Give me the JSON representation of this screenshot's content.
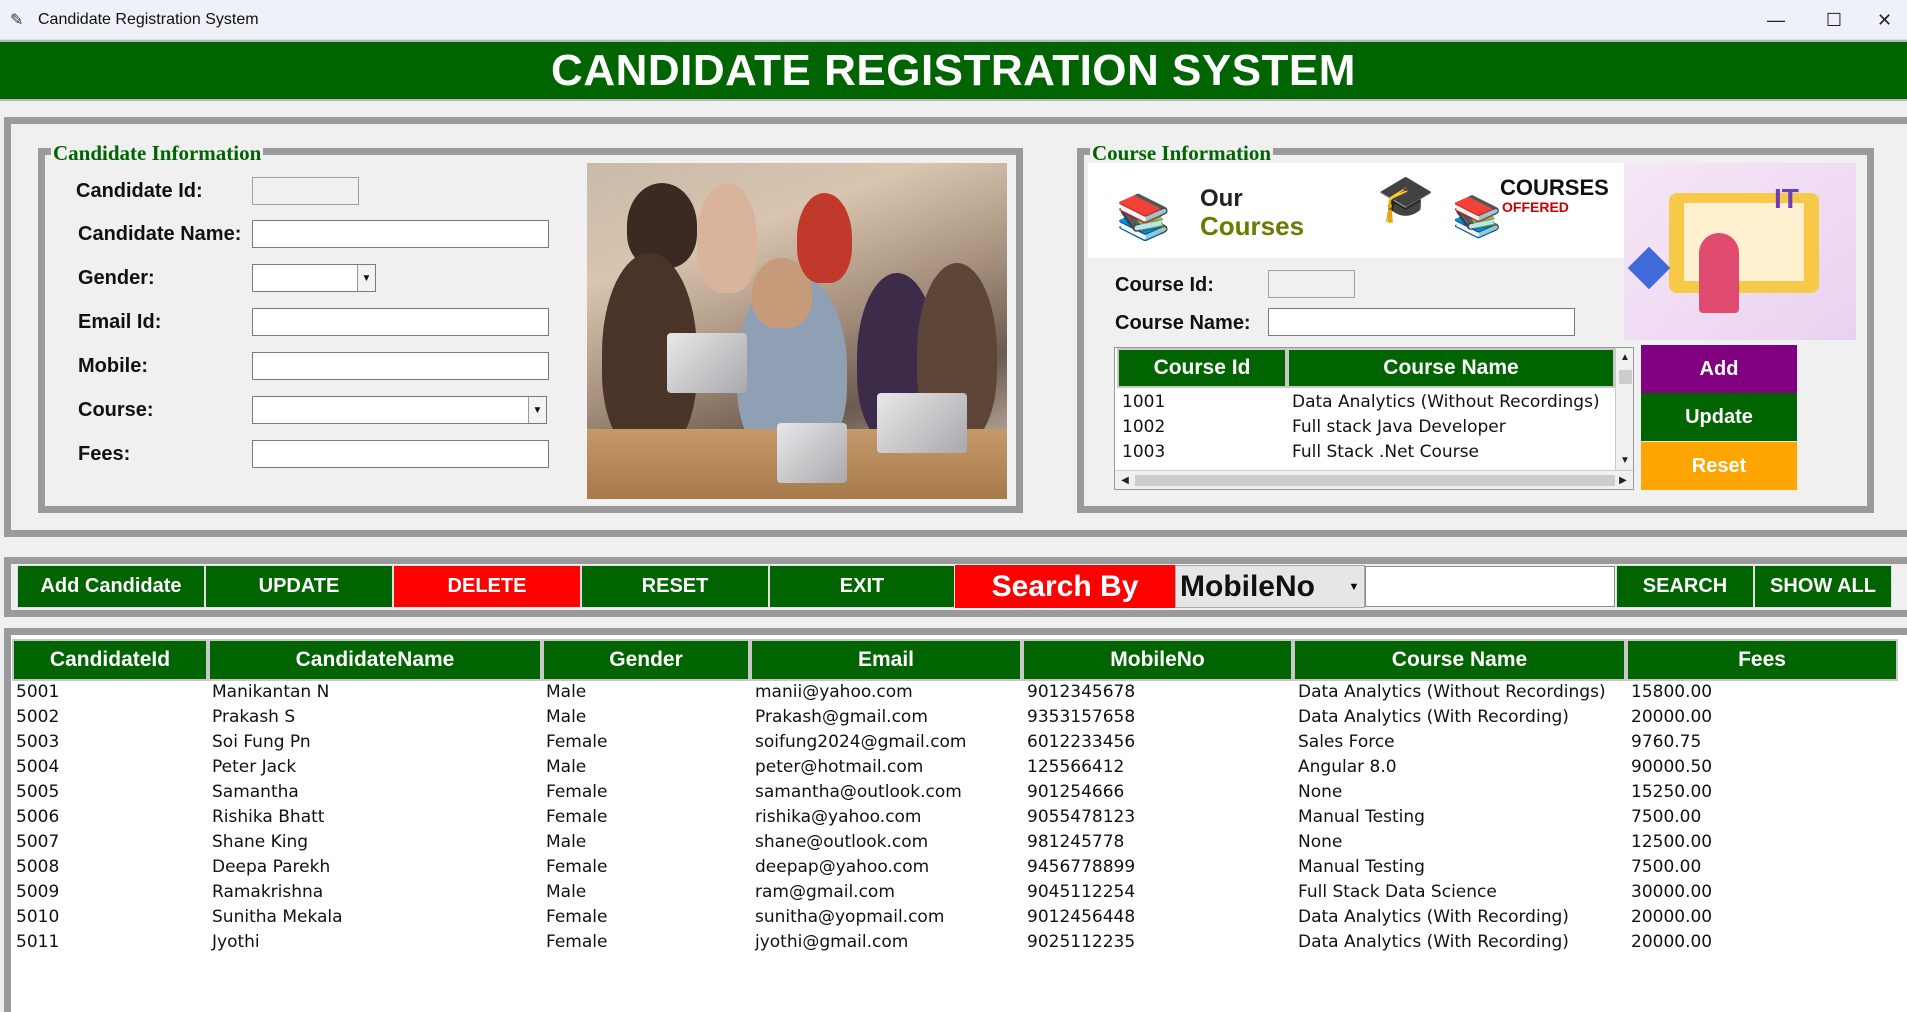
{
  "window": {
    "title": "Candidate Registration System"
  },
  "header": {
    "title": "CANDIDATE REGISTRATION SYSTEM"
  },
  "candidate_info": {
    "group_title": "Candidate Information",
    "labels": {
      "id": "Candidate Id:",
      "name": "Candidate Name:",
      "gender": "Gender:",
      "email": "Email Id:",
      "mobile": "Mobile:",
      "course": "Course:",
      "fees": "Fees:"
    },
    "values": {
      "id": "",
      "name": "",
      "gender": "",
      "email": "",
      "mobile": "",
      "course": "",
      "fees": ""
    }
  },
  "course_info": {
    "group_title": "Course Information",
    "banner1_line1": "Our",
    "banner1_line2": "Courses",
    "banner2_line1": "COURSES",
    "banner2_line2": "OFFERED",
    "banner3_text": "IT",
    "labels": {
      "id": "Course Id:",
      "name": "Course Name:"
    },
    "values": {
      "id": "",
      "name": ""
    },
    "table": {
      "columns": [
        "Course Id",
        "Course Name"
      ],
      "rows": [
        [
          "1001",
          "Data Analytics (Without Recordings)"
        ],
        [
          "1002",
          "Full stack Java Developer"
        ],
        [
          "1003",
          "Full Stack .Net Course"
        ]
      ]
    },
    "buttons": {
      "add": "Add",
      "update": "Update",
      "reset": "Reset"
    }
  },
  "toolbar": {
    "add_candidate": "Add Candidate",
    "update": "UPDATE",
    "delete": "DELETE",
    "reset": "RESET",
    "exit": "EXIT",
    "search_by": "Search By",
    "search_field": "MobileNo",
    "search_value": "",
    "search": "SEARCH",
    "show_all": "SHOW ALL"
  },
  "candidates_table": {
    "columns": [
      "CandidateId",
      "CandidateName",
      "Gender",
      "Email",
      "MobileNo",
      "Course Name",
      "Fees"
    ],
    "rows": [
      [
        "5001",
        "Manikantan N",
        "Male",
        "manii@yahoo.com",
        "9012345678",
        "Data Analytics (Without Recordings)",
        "15800.00"
      ],
      [
        "5002",
        "Prakash S",
        "Male",
        "Prakash@gmail.com",
        "9353157658",
        "Data Analytics (With Recording)",
        "20000.00"
      ],
      [
        "5003",
        "Soi Fung Pn",
        "Female",
        "soifung2024@gmail.com",
        "6012233456",
        "Sales Force",
        "9760.75"
      ],
      [
        "5004",
        "Peter Jack",
        "Male",
        "peter@hotmail.com",
        "125566412",
        "Angular 8.0",
        "90000.50"
      ],
      [
        "5005",
        "Samantha",
        "Female",
        "samantha@outlook.com",
        "901254666",
        "None",
        "15250.00"
      ],
      [
        "5006",
        "Rishika Bhatt",
        "Female",
        "rishika@yahoo.com",
        "9055478123",
        "Manual Testing",
        "7500.00"
      ],
      [
        "5007",
        "Shane King",
        "Male",
        "shane@outlook.com",
        "981245778",
        "None",
        "12500.00"
      ],
      [
        "5008",
        "Deepa Parekh",
        "Female",
        "deepap@yahoo.com",
        "9456778899",
        "Manual Testing",
        "7500.00"
      ],
      [
        "5009",
        "Ramakrishna",
        "Male",
        "ram@gmail.com",
        "9045112254",
        "Full Stack Data Science",
        "30000.00"
      ],
      [
        "5010",
        "Sunitha Mekala",
        "Female",
        "sunitha@yopmail.com",
        "9012456448",
        "Data Analytics (With Recording)",
        "20000.00"
      ],
      [
        "5011",
        "Jyothi",
        "Female",
        "jyothi@gmail.com",
        "9025112235",
        "Data Analytics (With Recording)",
        "20000.00"
      ]
    ]
  },
  "colors": {
    "green": "#006400",
    "red": "#ff0000",
    "purple": "#800080",
    "orange": "#ffa500"
  }
}
